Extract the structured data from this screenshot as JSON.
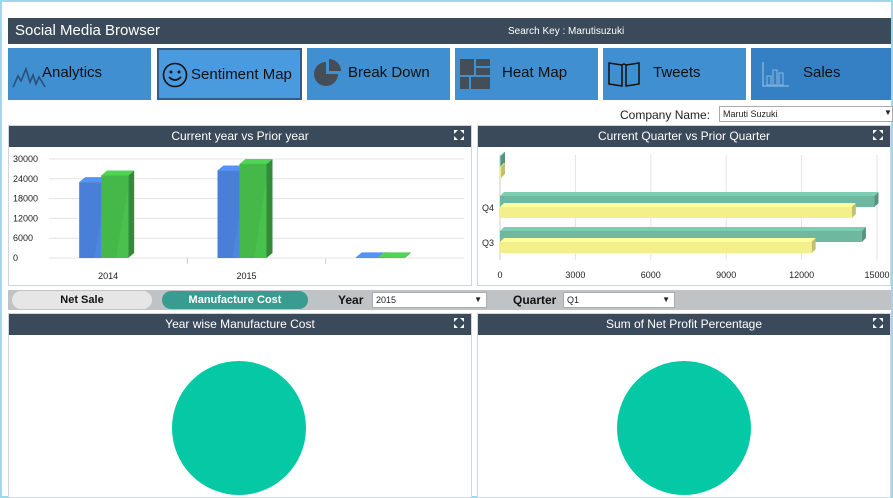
{
  "header": {
    "title": "Social Media Browser",
    "search_label": "Search Key :",
    "search_value": "Marutisuzuki"
  },
  "nav": {
    "analytics": "Analytics",
    "sentiment_map": "Sentiment Map",
    "break_down": "Break Down",
    "heat_map": "Heat Map",
    "tweets": "Tweets",
    "sales": "Sales"
  },
  "company": {
    "label": "Company Name:",
    "value": "Maruti Suzuki"
  },
  "panels": {
    "p1_title": "Current year vs Prior year",
    "p2_title": "Current Quarter vs Prior Quarter",
    "p3_title": "Year wise Manufacture Cost",
    "p4_title": "Sum of Net Profit Percentage"
  },
  "filters": {
    "net_sale": "Net Sale",
    "manufacture_cost": "Manufacture Cost",
    "year_label": "Year",
    "year_value": "2015",
    "quarter_label": "Quarter",
    "quarter_value": "Q1"
  },
  "colors": {
    "header_bg": "#3b4a5a",
    "nav_bg": "#3f8fd1",
    "teal": "#05c9a5",
    "blue_bar": "#4a7fd9",
    "green_bar": "#45b84a",
    "hbar_teal": "#6fb8a0",
    "hbar_yellow": "#f3f08c"
  },
  "chart_data": [
    {
      "type": "bar",
      "title": "Current year vs Prior year",
      "categories": [
        "2014",
        "2015",
        ""
      ],
      "series": [
        {
          "values": [
            23000,
            26500,
            200
          ]
        },
        {
          "values": [
            25000,
            28500,
            200
          ]
        }
      ],
      "ylim": [
        0,
        30000
      ],
      "yticks": [
        "0",
        "6000",
        "12000",
        "18000",
        "24000",
        "30000"
      ],
      "grid": true
    },
    {
      "type": "bar",
      "orientation": "horizontal",
      "title": "Current Quarter vs Prior Quarter",
      "categories": [
        "",
        "Q4",
        "Q3"
      ],
      "series": [
        {
          "values": [
            40,
            14900,
            14400
          ]
        },
        {
          "values": [
            40,
            14000,
            12400
          ]
        }
      ],
      "xlim": [
        0,
        15000
      ],
      "xticks": [
        "0",
        "3000",
        "6000",
        "9000",
        "12000",
        "15000"
      ],
      "grid": true
    },
    {
      "type": "pie",
      "title": "Year wise Manufacture Cost",
      "values": [
        100
      ]
    },
    {
      "type": "pie",
      "title": "Sum of Net Profit Percentage",
      "values": [
        100
      ]
    }
  ]
}
